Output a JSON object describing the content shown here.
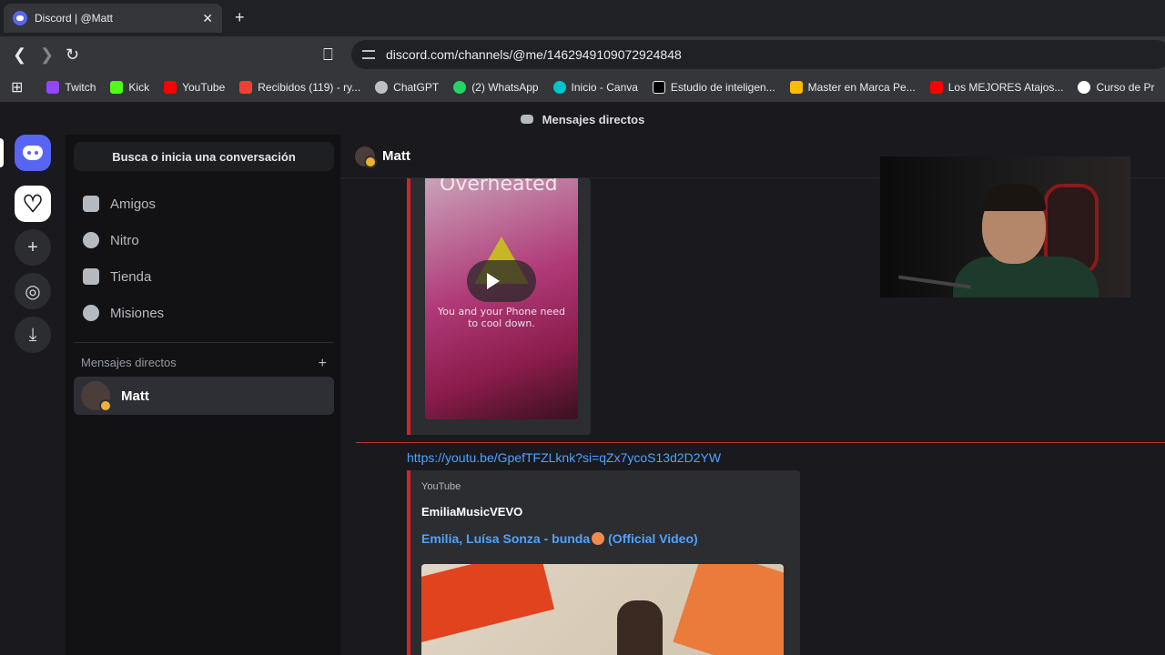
{
  "browser": {
    "tab_title": "Discord | @Matt",
    "url": "discord.com/channels/@me/1462949109072924848",
    "bookmarks": [
      {
        "label": "Twitch",
        "color": "#9146ff"
      },
      {
        "label": "Kick",
        "color": "#53fc18"
      },
      {
        "label": "YouTube",
        "color": "#ff0000"
      },
      {
        "label": "Recibidos (119) - ry...",
        "color": "#ea4335"
      },
      {
        "label": "ChatGPT",
        "color": "#bdc1c6"
      },
      {
        "label": "(2) WhatsApp",
        "color": "#25d366"
      },
      {
        "label": "Inicio - Canva",
        "color": "#00c4cc"
      },
      {
        "label": "Estudio de inteligen...",
        "color": "#000000"
      },
      {
        "label": "Master en Marca Pe...",
        "color": "#fbbc04"
      },
      {
        "label": "Los MEJORES Atajos...",
        "color": "#ff0000"
      },
      {
        "label": "Curso de Pr",
        "color": "#ffffff"
      }
    ]
  },
  "discord": {
    "topbar_title": "Mensajes directos",
    "search_placeholder": "Busca o inicia una conversación",
    "nav": [
      "Amigos",
      "Nitro",
      "Tienda",
      "Misiones"
    ],
    "dm_header": "Mensajes directos",
    "dm_add": "+",
    "dms": [
      {
        "name": "Matt"
      }
    ],
    "chat": {
      "title": "Matt",
      "embed1": {
        "overlay_title": "Overheated",
        "warning": "You and your Phone need to cool down."
      },
      "link": "https://youtu.be/GpefTFZLknk?si=qZx7ycoS13d2D2YW",
      "embed2": {
        "provider": "YouTube",
        "author": "EmiliaMusicVEVO",
        "title_part1": "Emilia, Luísa Sonza - bunda",
        "title_part2": "(Official Video)"
      }
    }
  },
  "colors": {
    "accent": "#5865f2",
    "link": "#4ea3ff",
    "embed_bar": "#da1f26"
  }
}
